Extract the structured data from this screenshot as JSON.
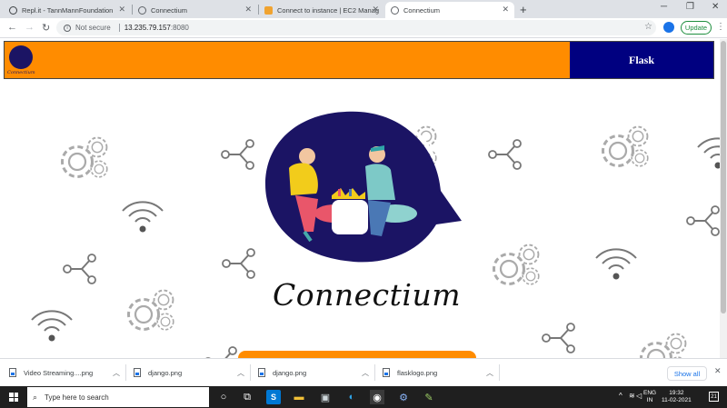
{
  "tabs": [
    {
      "title": "Repl.it - TannMannFoundation",
      "favicon": "replit-icon"
    },
    {
      "title": "Connectium",
      "favicon": "globe-icon"
    },
    {
      "title": "Connect to instance | EC2 Manag",
      "favicon": "aws-icon"
    },
    {
      "title": "Connectium",
      "favicon": "globe-icon",
      "active": true
    }
  ],
  "toolbar": {
    "security": "Not secure",
    "host": "13.235.79.157",
    "port": ":8080",
    "update_label": "Update"
  },
  "page": {
    "logo_text": "Connectium",
    "nav_link": "Flask",
    "brand_title": "Connectium",
    "colors": {
      "navbar": "#ff8c00",
      "nav_link_bg": "#000080",
      "hero": "#1b1464"
    }
  },
  "downloads": {
    "items": [
      "Video Streaming....png",
      "django.png",
      "django.png",
      "flasklogo.png"
    ],
    "show_all": "Show all"
  },
  "taskbar": {
    "search_placeholder": "Type here to search",
    "lang_top": "ENG",
    "lang_bottom": "IN",
    "time": "19:32",
    "date": "11-02-2021",
    "notification_count": "21"
  }
}
